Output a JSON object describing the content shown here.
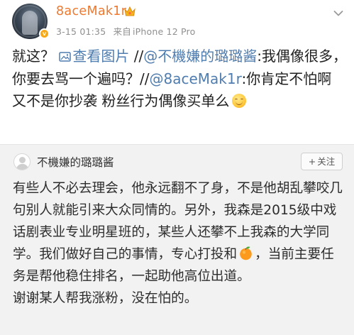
{
  "post": {
    "username": "8aceMak1r",
    "date": "3-15 01:35",
    "source_prefix": "来自",
    "source_device": "iPhone 12 Pro",
    "verified_badge": "v",
    "text_part1": "就这？ ",
    "view_image_label": "查看图片",
    "text_part2": " //",
    "mention1": "@不機嫌的璐璐酱",
    "text_part3": ":我偶像很多，你要去骂一个遍吗？//",
    "mention2": "@8aceMak1r",
    "text_part4": ":你肯定不怕啊 又不是你抄袭 粉丝行为偶像买单么",
    "icons": [
      "avatar",
      "crown-icon",
      "chevron-down-icon",
      "image-link-icon",
      "smile-emoji"
    ]
  },
  "repost": {
    "username": "不機嫌的璐璐酱",
    "follow_plus": "+",
    "follow_label": "关注",
    "text_part1": "有些人不必去理会，他永远翻不了身，不是他胡乱攀咬几句别人就能引来大众同情的。另外，我森是2015级中戏话剧表业专业明星班的，某些人还攀不上我森的大学同学。我们做好自己的事情，专心打投和",
    "text_part2": "，当前主要任务是帮他稳住排名，一起助他高位出道。",
    "text_part3": "谢谢某人帮我涨粉，没在怕的。",
    "icons": [
      "mini-avatar",
      "orange-emoji"
    ]
  },
  "colors": {
    "username": "#f0782c",
    "link": "#507daf",
    "meta": "#8f8f8f",
    "card_bg": "#f2f2f2",
    "badge": "#f7a917"
  }
}
